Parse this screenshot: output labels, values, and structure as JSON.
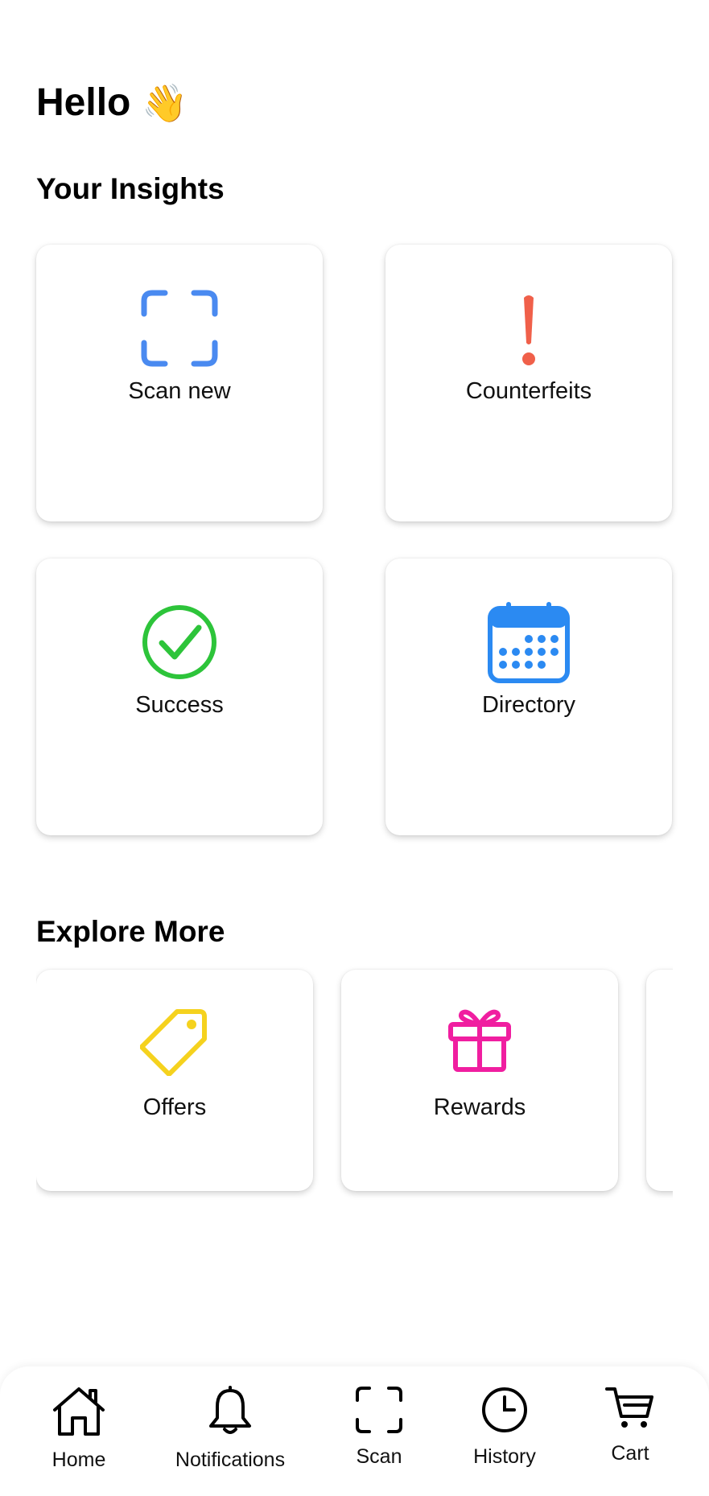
{
  "greeting": {
    "text": "Hello",
    "emoji": "👋"
  },
  "insights": {
    "title": "Your Insights",
    "cards": [
      {
        "label": "Scan new",
        "icon": "scan-frame-icon",
        "color": "#4A8AF0"
      },
      {
        "label": "Counterfeits",
        "icon": "exclamation-icon",
        "color": "#F0604A"
      },
      {
        "label": "Success",
        "icon": "check-circle-icon",
        "color": "#2DC43A"
      },
      {
        "label": "Directory",
        "icon": "calendar-icon",
        "color": "#2B8AF2"
      }
    ]
  },
  "explore": {
    "title": "Explore More",
    "cards": [
      {
        "label": "Offers",
        "icon": "tag-icon",
        "color": "#F5D21E"
      },
      {
        "label": "Rewards",
        "icon": "gift-icon",
        "color": "#F01EA0"
      }
    ]
  },
  "nav": {
    "items": [
      {
        "label": "Home",
        "icon": "home-icon"
      },
      {
        "label": "Notifications",
        "icon": "bell-icon"
      },
      {
        "label": "Scan",
        "icon": "scan-icon"
      },
      {
        "label": "History",
        "icon": "clock-icon"
      },
      {
        "label": "Cart",
        "icon": "cart-icon"
      }
    ]
  }
}
